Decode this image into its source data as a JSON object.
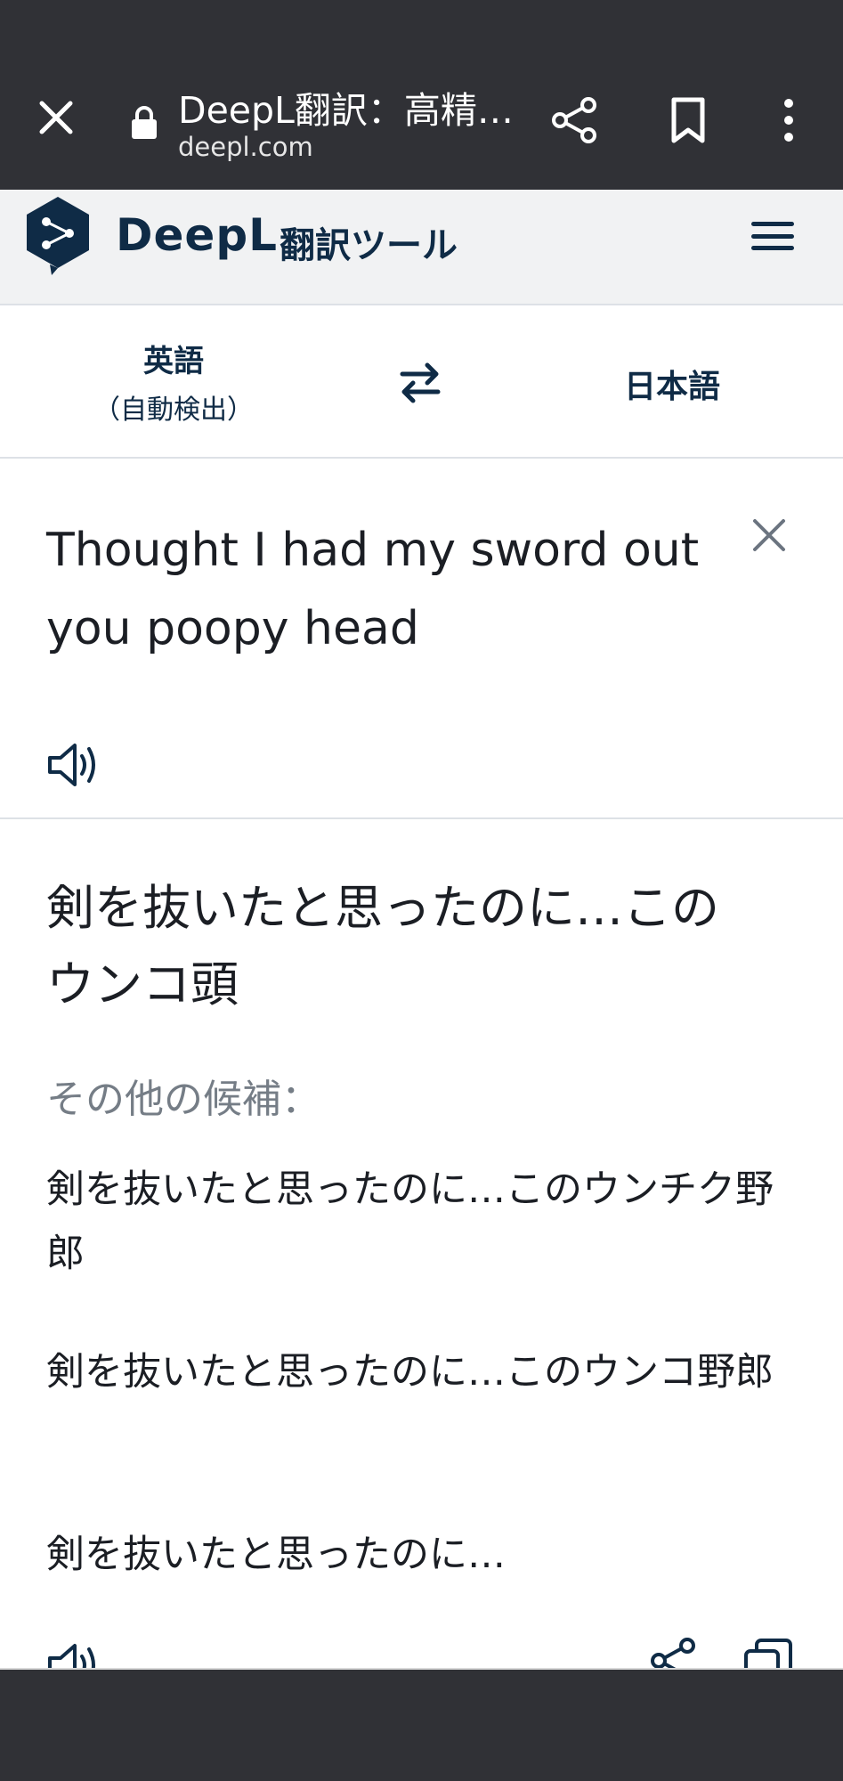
{
  "browser": {
    "title": "DeepL翻訳：高精…",
    "url": "deepl.com",
    "icons": [
      "close-icon",
      "lock-icon",
      "share-icon",
      "bookmark-icon",
      "more-vert-icon"
    ]
  },
  "header": {
    "brand": "DeepL",
    "subtitle": "翻訳ツール",
    "accent_color": "#0f2b46"
  },
  "languages": {
    "source_label": "英語",
    "source_detect": "（自動検出）",
    "target_label": "日本語"
  },
  "source": {
    "text": "Thought I had my sword out you poopy head"
  },
  "translation": {
    "main": "剣を抜いたと思ったのに…このウンコ頭",
    "alternatives_label": "その他の候補：",
    "alternatives": [
      "剣を抜いたと思ったのに…このウンチク野郎",
      "剣を抜いたと思ったのに…このウンコ野郎",
      "剣を抜いたと思ったのに…"
    ]
  }
}
